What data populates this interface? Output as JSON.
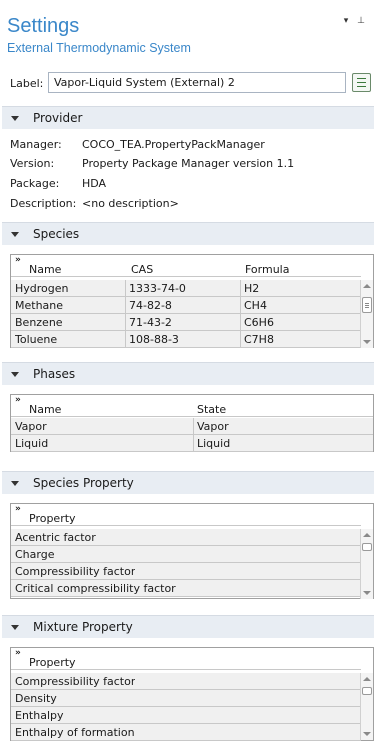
{
  "header": {
    "title": "Settings",
    "subtitle": "External Thermodynamic System",
    "controls": "▾ ⊥"
  },
  "label_row": {
    "label": "Label:",
    "value": "Vapor-Liquid System (External) 2"
  },
  "provider": {
    "title": "Provider",
    "fields": [
      {
        "key": "Manager:",
        "value": "COCO_TEA.PropertyPackManager"
      },
      {
        "key": "Version:",
        "value": "Property Package Manager version 1.1"
      },
      {
        "key": "Package:",
        "value": "HDA"
      },
      {
        "key": "Description:",
        "value": "<no description>"
      }
    ]
  },
  "species": {
    "title": "Species",
    "expand_glyph": "»",
    "headers": [
      "Name",
      "CAS",
      "Formula"
    ],
    "rows": [
      [
        "Hydrogen",
        "1333-74-0",
        "H2"
      ],
      [
        "Methane",
        "74-82-8",
        "CH4"
      ],
      [
        "Benzene",
        "71-43-2",
        "C6H6"
      ],
      [
        "Toluene",
        "108-88-3",
        "C7H8"
      ]
    ]
  },
  "phases": {
    "title": "Phases",
    "expand_glyph": "»",
    "headers": [
      "Name",
      "State"
    ],
    "rows": [
      [
        "Vapor",
        "Vapor"
      ],
      [
        "Liquid",
        "Liquid"
      ]
    ]
  },
  "species_property": {
    "title": "Species Property",
    "expand_glyph": "»",
    "header": "Property",
    "rows": [
      "Acentric factor",
      "Charge",
      "Compressibility factor",
      "Critical compressibility factor"
    ]
  },
  "mixture_property": {
    "title": "Mixture Property",
    "expand_glyph": "»",
    "header": "Property",
    "rows": [
      "Compressibility factor",
      "Density",
      "Enthalpy",
      "Enthalpy of formation"
    ]
  }
}
